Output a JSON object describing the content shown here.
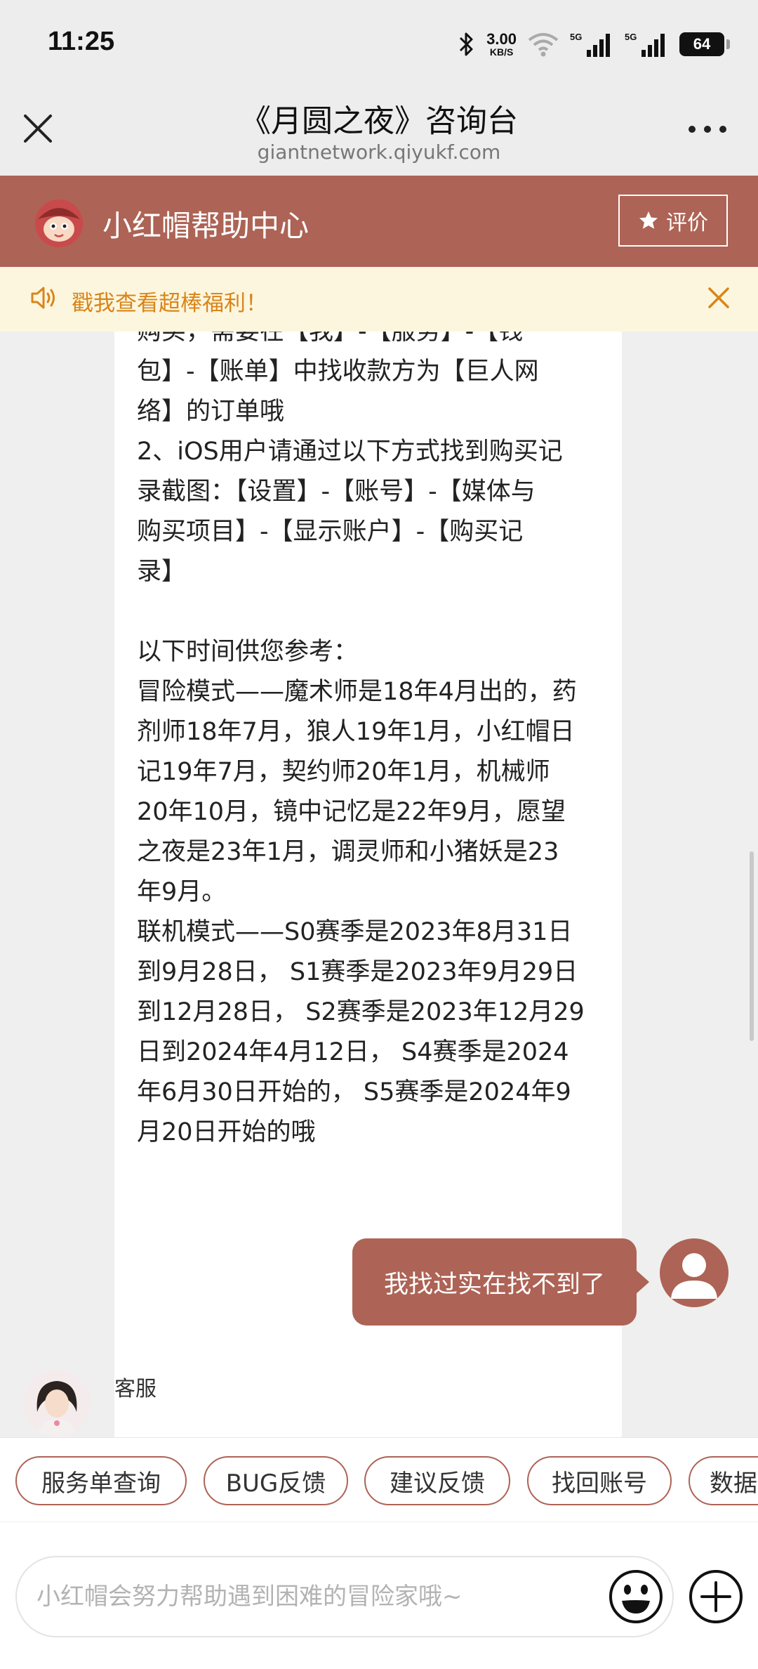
{
  "status_bar": {
    "time": "11:25",
    "net_speed_value": "3.00",
    "net_speed_unit": "KB/S",
    "battery": "64",
    "icons": [
      "bluetooth-icon",
      "wifi-icon",
      "signal-5g-icon",
      "signal-5g-icon",
      "battery-icon"
    ]
  },
  "title_bar": {
    "title": "《月圆之夜》咨询台",
    "url": "giantnetwork.qiyukf.com",
    "close_icon": "close-icon",
    "more_icon": "more-icon"
  },
  "brand": {
    "name": "小红帽帮助中心",
    "rate_label": "评价",
    "accent_color": "#ad6355"
  },
  "notice": {
    "text": "戳我查看超棒福利！",
    "text_color": "#d9851a"
  },
  "messages": {
    "agent_reply_lines": [
      "购买，需要在【我】-【服务】-【钱",
      "包】-【账单】中找收款方为【巨人网",
      "络】的订单哦",
      "2、iOS用户请通过以下方式找到购买记",
      "录截图：【设置】-【账号】-【媒体与",
      "购买项目】-【显示账户】-【购买记",
      "录】",
      "",
      "以下时间供您参考：",
      "冒险模式——魔术师是18年4月出的，药",
      "剂师18年7月，狼人19年1月，小红帽日",
      "记19年7月，契约师20年1月，机械师",
      "20年10月，镜中记忆是22年9月，愿望",
      "之夜是23年1月，调灵师和小猪妖是23",
      "年9月。",
      "联机模式——S0赛季是2023年8月31日",
      "到9月28日， S1赛季是2023年9月29日",
      "到12月28日， S2赛季是2023年12月29",
      "日到2024年4月12日， S4赛季是2024",
      "年6月30日开始的， S5赛季是2024年9",
      "月20日开始的哦"
    ],
    "user_message": "我找过实在找不到了",
    "agent_label": "客服"
  },
  "quick_actions": [
    "服务单查询",
    "BUG反馈",
    "建议反馈",
    "找回账号",
    "数据"
  ],
  "input": {
    "placeholder": "小红帽会努力帮助遇到困难的冒险家哦~",
    "value": ""
  }
}
